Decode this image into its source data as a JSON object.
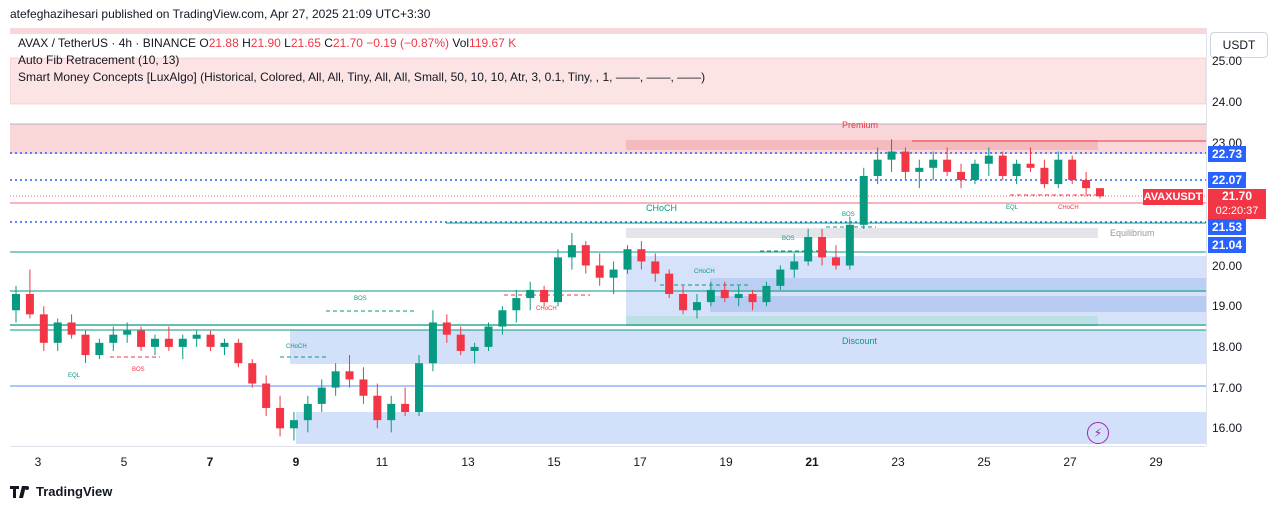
{
  "header": {
    "published": "atefeghazihesari published on TradingView.com, Apr 27, 2025 21:09 UTC+3:30"
  },
  "legend": {
    "symbol": "AVAX / TetherUS · 4h · BINANCE",
    "open_label": "O",
    "open": "21.88",
    "high_label": "H",
    "high": "21.90",
    "low_label": "L",
    "low": "21.65",
    "close_label": "C",
    "close": "21.70",
    "change": "−0.19 (−0.87%)",
    "vol_label": "Vol",
    "vol": "119.67 K",
    "indicator1": "Auto Fib Retracement (10, 13)",
    "indicator2": "Smart Money Concepts [LuxAlgo] (Historical, Colored, All, All, Tiny, All, All, Small, 50, 10, 10, Atr, 3, 0.1, Tiny, , 1, ——, ——, ——)"
  },
  "price_scale": {
    "currency": "USDT",
    "ticks": [
      "25.00",
      "24.00",
      "23.00",
      "20.00",
      "19.00",
      "18.00",
      "17.00",
      "16.00"
    ],
    "labels": [
      {
        "value": "22.73",
        "color": "#2962ff"
      },
      {
        "value": "22.07",
        "color": "#2962ff"
      },
      {
        "value": "21.53",
        "color": "#2962ff"
      },
      {
        "value": "21.04",
        "color": "#2962ff"
      }
    ],
    "ticker": "AVAXUSDT",
    "last_price": "21.70",
    "countdown": "02:20:37"
  },
  "time_axis": [
    "3",
    "5",
    "7",
    "9",
    "11",
    "13",
    "15",
    "17",
    "19",
    "21",
    "23",
    "25",
    "27",
    "29"
  ],
  "annotations": {
    "premium": "Premium",
    "equilibrium": "Equilibrium",
    "discount": "Discount",
    "choch": "CHoCH",
    "bos": "BOS",
    "eql": "EQL"
  },
  "brand": "TradingView",
  "colors": {
    "up": "#089981",
    "down": "#f23645",
    "accent": "#2962ff"
  },
  "chart_data": {
    "type": "candlestick",
    "symbol": "AVAX / TetherUS",
    "timeframe": "4h",
    "y_range": [
      15.5,
      25.5
    ],
    "candles": [
      [
        18.9,
        19.5,
        18.6,
        19.3
      ],
      [
        19.3,
        19.9,
        18.7,
        18.8
      ],
      [
        18.8,
        19.0,
        17.9,
        18.1
      ],
      [
        18.1,
        18.7,
        17.9,
        18.6
      ],
      [
        18.6,
        18.8,
        18.2,
        18.3
      ],
      [
        18.3,
        18.4,
        17.6,
        17.8
      ],
      [
        17.8,
        18.2,
        17.7,
        18.1
      ],
      [
        18.1,
        18.5,
        17.9,
        18.3
      ],
      [
        18.3,
        18.6,
        18.1,
        18.4
      ],
      [
        18.4,
        18.5,
        17.9,
        18.0
      ],
      [
        18.0,
        18.3,
        17.8,
        18.2
      ],
      [
        18.2,
        18.5,
        17.9,
        18.0
      ],
      [
        18.0,
        18.3,
        17.7,
        18.2
      ],
      [
        18.2,
        18.4,
        18.0,
        18.3
      ],
      [
        18.3,
        18.4,
        17.9,
        18.0
      ],
      [
        18.0,
        18.2,
        17.8,
        18.1
      ],
      [
        18.1,
        18.2,
        17.5,
        17.6
      ],
      [
        17.6,
        17.7,
        17.0,
        17.1
      ],
      [
        17.1,
        17.3,
        16.3,
        16.5
      ],
      [
        16.5,
        16.8,
        15.8,
        16.0
      ],
      [
        16.0,
        16.4,
        15.7,
        16.2
      ],
      [
        16.2,
        16.8,
        15.9,
        16.6
      ],
      [
        16.6,
        17.2,
        16.4,
        17.0
      ],
      [
        17.0,
        17.6,
        16.8,
        17.4
      ],
      [
        17.4,
        17.8,
        17.0,
        17.2
      ],
      [
        17.2,
        17.5,
        16.6,
        16.8
      ],
      [
        16.8,
        17.1,
        16.0,
        16.2
      ],
      [
        16.2,
        16.8,
        15.9,
        16.6
      ],
      [
        16.6,
        17.0,
        16.3,
        16.4
      ],
      [
        16.4,
        17.8,
        16.3,
        17.6
      ],
      [
        17.6,
        18.9,
        17.4,
        18.6
      ],
      [
        18.6,
        18.8,
        18.1,
        18.3
      ],
      [
        18.3,
        18.5,
        17.8,
        17.9
      ],
      [
        17.9,
        18.1,
        17.6,
        18.0
      ],
      [
        18.0,
        18.6,
        17.9,
        18.5
      ],
      [
        18.5,
        19.0,
        18.3,
        18.9
      ],
      [
        18.9,
        19.4,
        18.6,
        19.2
      ],
      [
        19.2,
        19.6,
        18.9,
        19.4
      ],
      [
        19.4,
        19.5,
        19.0,
        19.1
      ],
      [
        19.1,
        20.4,
        19.0,
        20.2
      ],
      [
        20.2,
        20.8,
        19.9,
        20.5
      ],
      [
        20.5,
        20.6,
        19.8,
        20.0
      ],
      [
        20.0,
        20.3,
        19.5,
        19.7
      ],
      [
        19.7,
        20.1,
        19.3,
        19.9
      ],
      [
        19.9,
        20.5,
        19.8,
        20.4
      ],
      [
        20.4,
        20.6,
        19.9,
        20.1
      ],
      [
        20.1,
        20.3,
        19.6,
        19.8
      ],
      [
        19.8,
        19.9,
        19.2,
        19.3
      ],
      [
        19.3,
        19.5,
        18.8,
        18.9
      ],
      [
        18.9,
        19.3,
        18.7,
        19.1
      ],
      [
        19.1,
        19.6,
        19.0,
        19.4
      ],
      [
        19.4,
        19.6,
        19.1,
        19.2
      ],
      [
        19.2,
        19.5,
        19.0,
        19.3
      ],
      [
        19.3,
        19.4,
        18.9,
        19.1
      ],
      [
        19.1,
        19.6,
        19.0,
        19.5
      ],
      [
        19.5,
        20.0,
        19.4,
        19.9
      ],
      [
        19.9,
        20.3,
        19.7,
        20.1
      ],
      [
        20.1,
        20.9,
        20.0,
        20.7
      ],
      [
        20.7,
        20.9,
        20.0,
        20.2
      ],
      [
        20.2,
        20.5,
        19.9,
        20.0
      ],
      [
        20.0,
        21.2,
        19.9,
        21.0
      ],
      [
        21.0,
        22.4,
        20.9,
        22.2
      ],
      [
        22.2,
        22.9,
        22.0,
        22.6
      ],
      [
        22.6,
        23.1,
        22.3,
        22.8
      ],
      [
        22.8,
        22.9,
        22.1,
        22.3
      ],
      [
        22.3,
        22.6,
        21.9,
        22.4
      ],
      [
        22.4,
        22.8,
        22.1,
        22.6
      ],
      [
        22.6,
        22.9,
        22.2,
        22.3
      ],
      [
        22.3,
        22.5,
        21.9,
        22.1
      ],
      [
        22.1,
        22.6,
        22.0,
        22.5
      ],
      [
        22.5,
        22.9,
        22.2,
        22.7
      ],
      [
        22.7,
        22.8,
        22.1,
        22.2
      ],
      [
        22.2,
        22.6,
        22.0,
        22.5
      ],
      [
        22.5,
        22.9,
        22.3,
        22.4
      ],
      [
        22.4,
        22.6,
        21.9,
        22.0
      ],
      [
        22.0,
        22.8,
        21.9,
        22.6
      ],
      [
        22.6,
        22.7,
        22.0,
        22.1
      ],
      [
        22.1,
        22.3,
        21.7,
        21.9
      ],
      [
        21.9,
        21.9,
        21.65,
        21.7
      ]
    ]
  }
}
